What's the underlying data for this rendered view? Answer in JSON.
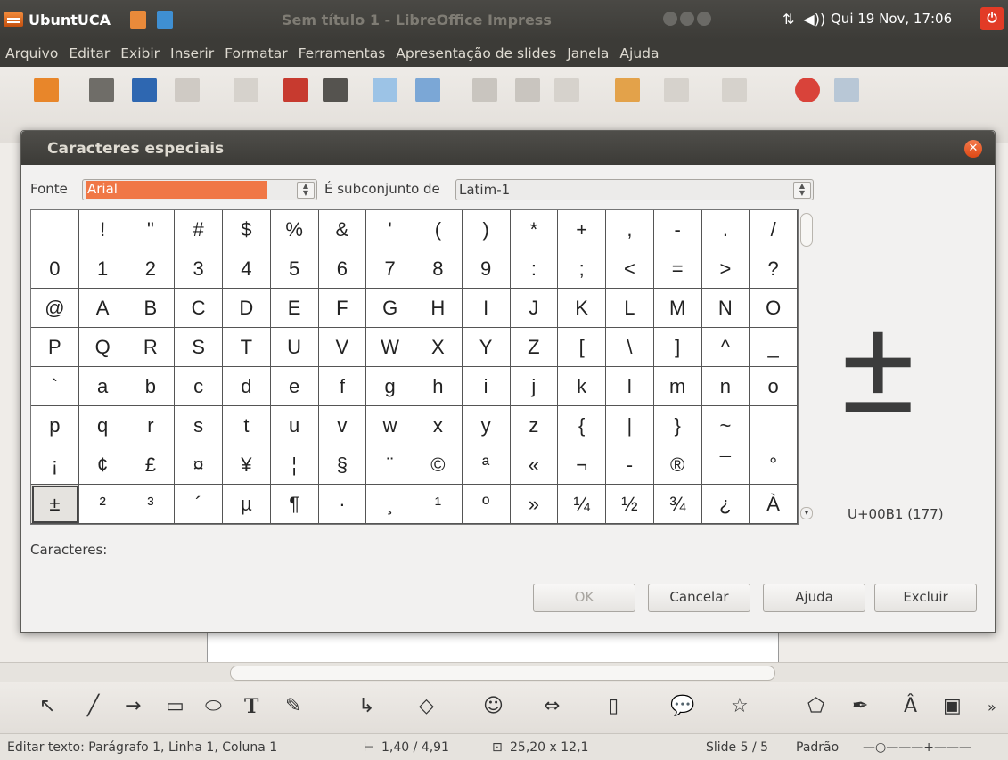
{
  "panel": {
    "app_name": "UbuntUCA",
    "window_title": "Sem título 1 - LibreOffice Impress",
    "clock": "Qui 19 Nov, 17:06"
  },
  "menu": [
    "Arquivo",
    "Editar",
    "Exibir",
    "Inserir",
    "Formatar",
    "Ferramentas",
    "Apresentação de slides",
    "Janela",
    "Ajuda"
  ],
  "dialog": {
    "title": "Caracteres especiais",
    "font_label": "Fonte",
    "font_value": "Arial",
    "subset_label": "É subconjunto de",
    "subset_value": "Latim-1",
    "characters": [
      " ",
      "!",
      "\"",
      "#",
      "$",
      "%",
      "&",
      "'",
      "(",
      ")",
      "*",
      "+",
      ",",
      "-",
      ".",
      "/",
      "0",
      "1",
      "2",
      "3",
      "4",
      "5",
      "6",
      "7",
      "8",
      "9",
      ":",
      ";",
      "<",
      "=",
      ">",
      "?",
      "@",
      "A",
      "B",
      "C",
      "D",
      "E",
      "F",
      "G",
      "H",
      "I",
      "J",
      "K",
      "L",
      "M",
      "N",
      "O",
      "P",
      "Q",
      "R",
      "S",
      "T",
      "U",
      "V",
      "W",
      "X",
      "Y",
      "Z",
      "[",
      "\\",
      "]",
      "^",
      "_",
      "`",
      "a",
      "b",
      "c",
      "d",
      "e",
      "f",
      "g",
      "h",
      "i",
      "j",
      "k",
      "l",
      "m",
      "n",
      "o",
      "p",
      "q",
      "r",
      "s",
      "t",
      "u",
      "v",
      "w",
      "x",
      "y",
      "z",
      "{",
      "|",
      "}",
      "~",
      " ",
      "¡",
      "¢",
      "£",
      "¤",
      "¥",
      "¦",
      "§",
      "¨",
      "©",
      "ª",
      "«",
      "¬",
      "-",
      "®",
      "¯",
      "°",
      "±",
      "²",
      "³",
      "´",
      "µ",
      "¶",
      "·",
      "¸",
      "¹",
      "º",
      "»",
      "¼",
      "½",
      "¾",
      "¿",
      "À"
    ],
    "selected_index": 112,
    "preview_char": "±",
    "codepoint": "U+00B1 (177)",
    "characters_label": "Caracteres:",
    "buttons": {
      "ok": "OK",
      "cancel": "Cancelar",
      "help": "Ajuda",
      "delete": "Excluir"
    }
  },
  "status": {
    "edit": "Editar texto: Parágrafo 1, Linha 1, Coluna 1",
    "position": "1,40 / 4,91",
    "size": "25,20 x 12,1",
    "slide": "Slide 5 / 5",
    "layout": "Padrão"
  }
}
